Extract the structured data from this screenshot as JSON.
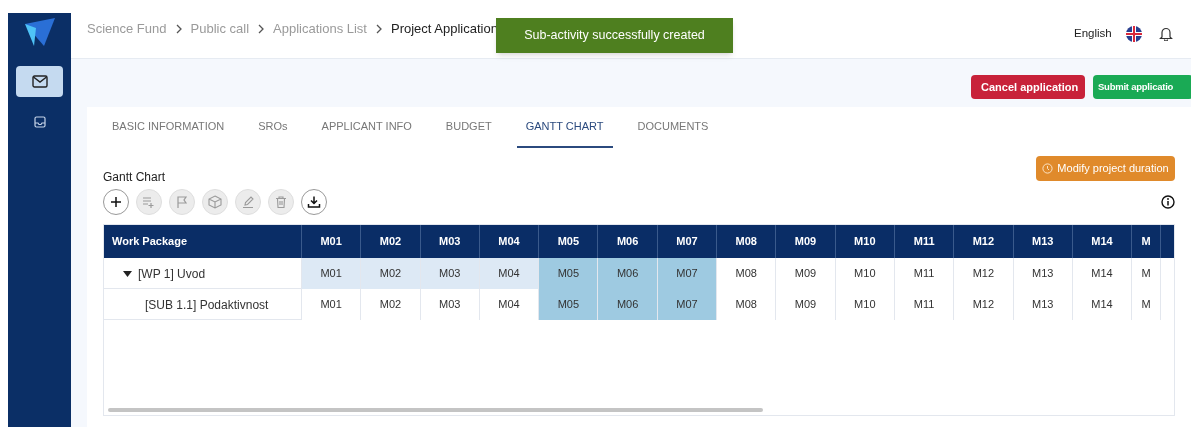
{
  "breadcrumb": [
    {
      "label": "Science Fund",
      "current": false
    },
    {
      "label": "Public call",
      "current": false
    },
    {
      "label": "Applications List",
      "current": false
    },
    {
      "label": "Project Application",
      "current": true
    }
  ],
  "toast": {
    "text": "Sub-activity successfully created"
  },
  "header": {
    "language": "English"
  },
  "actions": [
    {
      "kind": "cancel",
      "label": "Cancel application"
    },
    {
      "kind": "submit",
      "label": "Submit applicatio"
    }
  ],
  "tabs": [
    {
      "label": "BASIC INFORMATION",
      "selected": false
    },
    {
      "label": "SROs",
      "selected": false
    },
    {
      "label": "APPLICANT INFO",
      "selected": false
    },
    {
      "label": "BUDGET",
      "selected": false
    },
    {
      "label": "GANTT CHART",
      "selected": true
    },
    {
      "label": "DOCUMENTS",
      "selected": false
    }
  ],
  "gantt": {
    "title": "Gantt Chart",
    "modify_button": "Modify project duration",
    "toolbar": [
      {
        "kind": "add",
        "disabled": false
      },
      {
        "kind": "add-list",
        "disabled": true
      },
      {
        "kind": "flag",
        "disabled": true
      },
      {
        "kind": "package",
        "disabled": true
      },
      {
        "kind": "edit",
        "disabled": true
      },
      {
        "kind": "delete",
        "disabled": true
      },
      {
        "kind": "download",
        "disabled": false
      }
    ],
    "work_package_header": "Work Package",
    "months": [
      "M01",
      "M02",
      "M03",
      "M04",
      "M05",
      "M06",
      "M07",
      "M08",
      "M09",
      "M10",
      "M11",
      "M12",
      "M13",
      "M14",
      "M"
    ],
    "rows": [
      {
        "label": "[WP 1] Uvod",
        "expanded": true,
        "cells": [
          {
            "text": "M01",
            "highlight": true,
            "active": false
          },
          {
            "text": "M02",
            "highlight": true,
            "active": false
          },
          {
            "text": "M03",
            "highlight": true,
            "active": false
          },
          {
            "text": "M04",
            "highlight": true,
            "active": false
          },
          {
            "text": "M05",
            "highlight": true,
            "active": true
          },
          {
            "text": "M06",
            "highlight": true,
            "active": true
          },
          {
            "text": "M07",
            "highlight": true,
            "active": true
          },
          {
            "text": "M08",
            "highlight": false,
            "active": false
          },
          {
            "text": "M09",
            "highlight": false,
            "active": false
          },
          {
            "text": "M10",
            "highlight": false,
            "active": false
          },
          {
            "text": "M11",
            "highlight": false,
            "active": false
          },
          {
            "text": "M12",
            "highlight": false,
            "active": false
          },
          {
            "text": "M13",
            "highlight": false,
            "active": false
          },
          {
            "text": "M14",
            "highlight": false,
            "active": false
          },
          {
            "text": "M",
            "highlight": false,
            "active": false
          }
        ],
        "children": [
          {
            "label": "[SUB 1.1] Podaktivnost",
            "cells": [
              {
                "text": "M01",
                "highlight": false,
                "active": false
              },
              {
                "text": "M02",
                "highlight": false,
                "active": false
              },
              {
                "text": "M03",
                "highlight": false,
                "active": false
              },
              {
                "text": "M04",
                "highlight": false,
                "active": false
              },
              {
                "text": "M05",
                "highlight": true,
                "active": true
              },
              {
                "text": "M06",
                "highlight": true,
                "active": true
              },
              {
                "text": "M07",
                "highlight": true,
                "active": true
              },
              {
                "text": "M08",
                "highlight": false,
                "active": false
              },
              {
                "text": "M09",
                "highlight": false,
                "active": false
              },
              {
                "text": "M10",
                "highlight": false,
                "active": false
              },
              {
                "text": "M11",
                "highlight": false,
                "active": false
              },
              {
                "text": "M12",
                "highlight": false,
                "active": false
              },
              {
                "text": "M13",
                "highlight": false,
                "active": false
              },
              {
                "text": "M14",
                "highlight": false,
                "active": false
              },
              {
                "text": "M",
                "highlight": false,
                "active": false
              }
            ]
          }
        ]
      }
    ]
  }
}
